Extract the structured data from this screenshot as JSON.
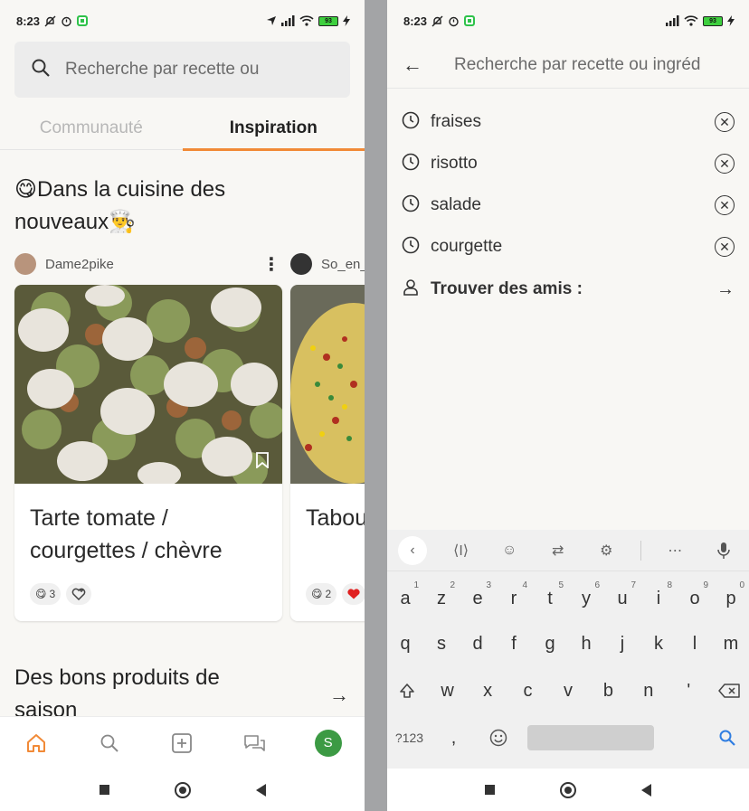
{
  "status": {
    "time": "8:23",
    "battery": "93"
  },
  "left": {
    "search_placeholder": "Recherche par recette ou",
    "tabs": [
      {
        "label": "Communauté"
      },
      {
        "label": "Inspiration"
      }
    ],
    "section_title": "😋Dans la cuisine des nouveaux👨‍🍳",
    "cards": [
      {
        "user": "Dame2pike",
        "title": "Tarte tomate / courgettes / chèvre",
        "reaction_emoji": "😋",
        "reaction_count": "3",
        "fav_icon": "heart-plus-icon"
      },
      {
        "user": "So_en_c",
        "title": "Tabou",
        "reaction_emoji": "😋",
        "reaction_count": "2",
        "fav_icon": "heart-icon"
      }
    ],
    "section2_title": "Des bons produits de saison",
    "nav": [
      "home-icon",
      "search-icon",
      "add-icon",
      "chat-icon",
      "profile-avatar"
    ],
    "profile_initial": "S"
  },
  "right": {
    "search_placeholder": "Recherche par recette ou ingréd",
    "history": [
      {
        "label": "fraises"
      },
      {
        "label": "risotto"
      },
      {
        "label": "salade"
      },
      {
        "label": "courgette"
      }
    ],
    "friends_label": "Trouver des amis :",
    "keyboard": {
      "row1": [
        {
          "k": "a",
          "s": "1"
        },
        {
          "k": "z",
          "s": "2"
        },
        {
          "k": "e",
          "s": "3"
        },
        {
          "k": "r",
          "s": "4"
        },
        {
          "k": "t",
          "s": "5"
        },
        {
          "k": "y",
          "s": "6"
        },
        {
          "k": "u",
          "s": "7"
        },
        {
          "k": "i",
          "s": "8"
        },
        {
          "k": "o",
          "s": "9"
        },
        {
          "k": "p",
          "s": "0"
        }
      ],
      "row2": [
        "q",
        "s",
        "d",
        "f",
        "g",
        "h",
        "j",
        "k",
        "l",
        "m"
      ],
      "row3": [
        "w",
        "x",
        "c",
        "v",
        "b",
        "n",
        "'"
      ],
      "sym_label": "?123",
      "comma": ","
    }
  },
  "colors": {
    "accent": "#f18a37",
    "profile": "#3c9a44",
    "reaction_heart": "#e02020"
  }
}
